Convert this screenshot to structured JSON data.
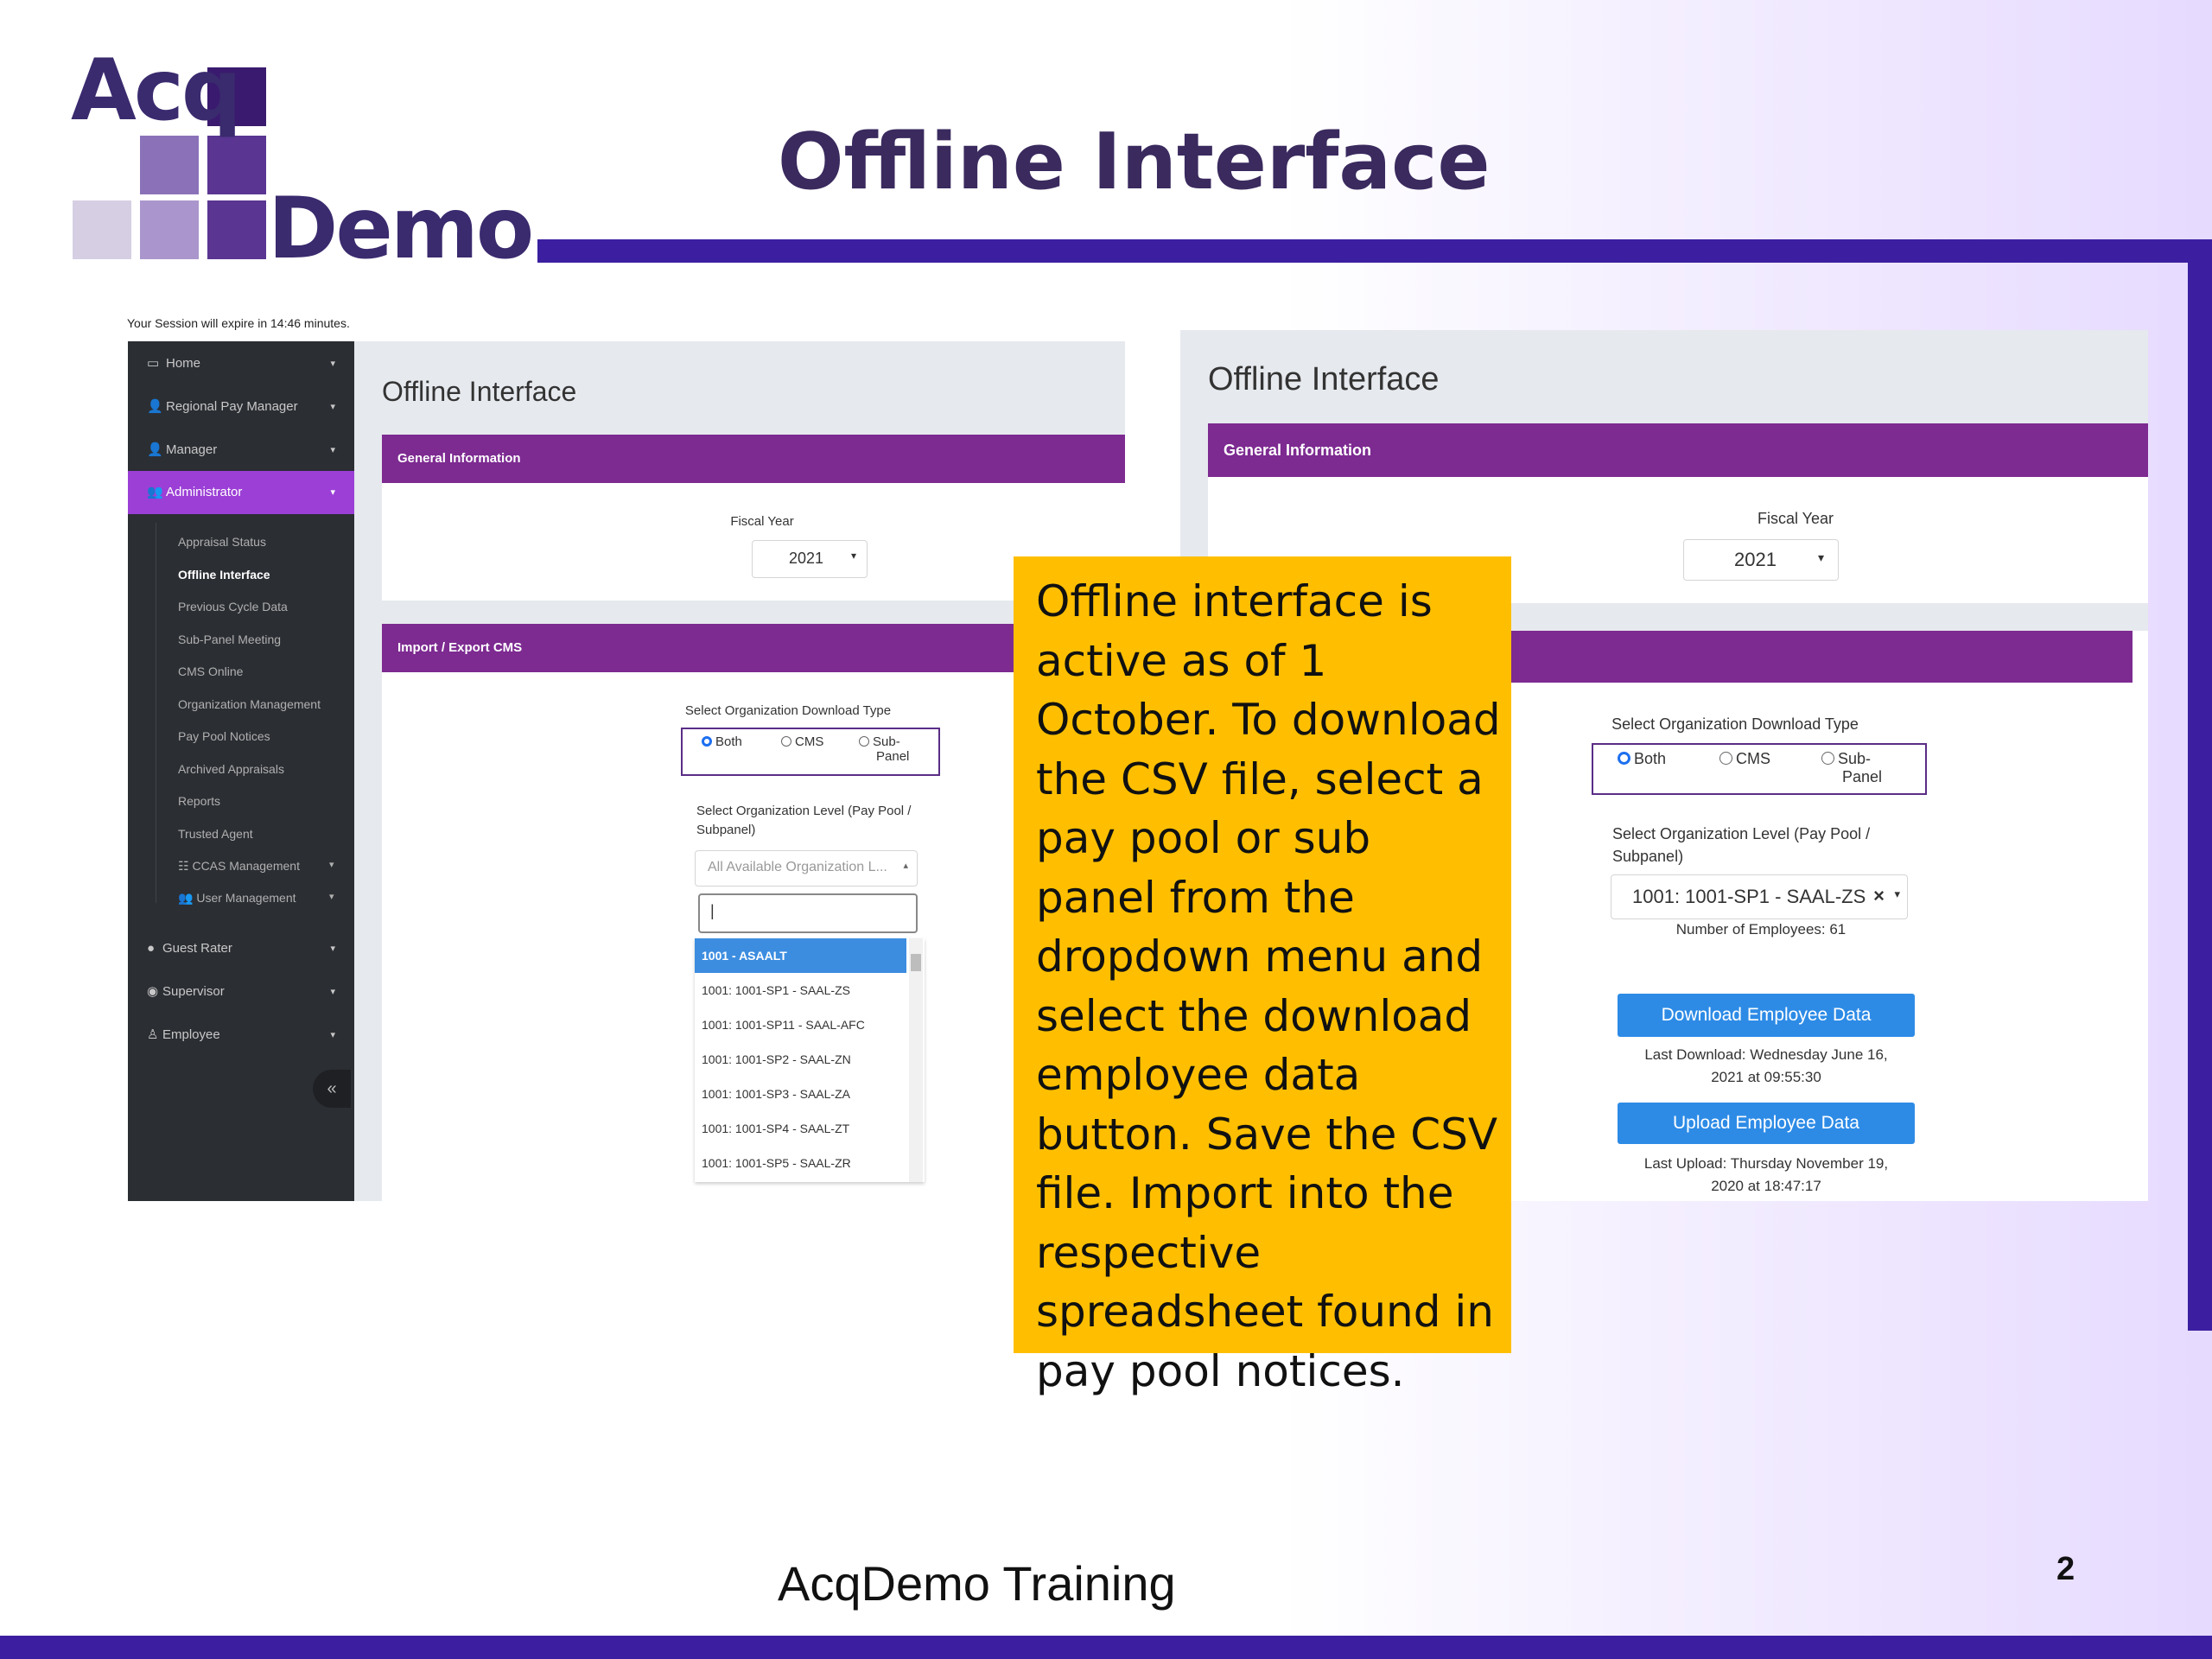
{
  "slide": {
    "title": "Offline Interface",
    "footer": "AcqDemo Training",
    "page_number": "2",
    "logo": {
      "line1": "Acq",
      "line2": "Demo"
    }
  },
  "colors": {
    "accent": "#3b1fa0",
    "purple_header": "#7d2a91",
    "sidebar_active": "#9b3fd6",
    "callout": "#ffbf00",
    "button": "#2d8be6"
  },
  "left_screen": {
    "session_notice": "Your Session will expire in 14:46 minutes.",
    "sidebar": {
      "items": [
        {
          "label": "Home",
          "icon": "laptop-icon"
        },
        {
          "label": "Regional Pay Manager",
          "icon": "user-gear-icon"
        },
        {
          "label": "Manager",
          "icon": "user-gear-icon"
        },
        {
          "label": "Administrator",
          "icon": "users-gear-icon"
        }
      ],
      "sub_items": [
        "Appraisal Status",
        "Offline Interface",
        "Previous Cycle Data",
        "Sub-Panel Meeting",
        "CMS Online",
        "Organization Management",
        "Pay Pool Notices",
        "Archived Appraisals",
        "Reports",
        "Trusted Agent",
        "CCAS Management",
        "User Management"
      ],
      "lower_items": [
        {
          "label": "Guest Rater",
          "icon": "guest-icon"
        },
        {
          "label": "Supervisor",
          "icon": "supervisor-icon"
        },
        {
          "label": "Employee",
          "icon": "employee-icon"
        }
      ],
      "collapse": "«"
    },
    "page_title": "Offline Interface",
    "general_info_header": "General Information",
    "fiscal_year_label": "Fiscal Year",
    "fiscal_year_value": "2021",
    "import_export_header": "Import / Export CMS",
    "download_type_label": "Select Organization Download Type",
    "radio_both": "Both",
    "radio_cms": "CMS",
    "radio_sub": "Sub-",
    "radio_sub2": "Panel",
    "org_level_label": "Select Organization Level (Pay Pool /",
    "org_level_label2": "Subpanel)",
    "org_select_placeholder": "All Available Organization L...",
    "search_value": "|",
    "dropdown_options": [
      "1001 - ASAALT",
      "1001: 1001-SP1 - SAAL-ZS",
      "1001: 1001-SP11 - SAAL-AFC",
      "1001: 1001-SP2 - SAAL-ZN",
      "1001: 1001-SP3 - SAAL-ZA",
      "1001: 1001-SP4 - SAAL-ZT",
      "1001: 1001-SP5 - SAAL-ZR"
    ]
  },
  "right_screen": {
    "page_title": "Offline Interface",
    "general_info_header": "General Information",
    "fiscal_year_label": "Fiscal Year",
    "fiscal_year_value": "2021",
    "download_type_label": "Select Organization Download Type",
    "radio_both": "Both",
    "radio_cms": "CMS",
    "radio_sub": "Sub-",
    "radio_sub2": "Panel",
    "org_level_label": "Select Organization Level (Pay Pool /",
    "org_level_label2": "Subpanel)",
    "org_selected": "1001: 1001-SP1 - SAAL-ZS",
    "employee_count": "Number of Employees: 61",
    "download_button": "Download Employee Data",
    "last_download": "Last Download: Wednesday June 16,",
    "last_download2": "2021 at 09:55:30",
    "upload_button": "Upload Employee Data",
    "last_upload": "Last Upload: Thursday November 19,",
    "last_upload2": "2020 at 18:47:17"
  },
  "callout": {
    "text": "Offline interface is active as of 1 October. To download the CSV file, select a pay pool or sub panel from the dropdown menu and select the download employee data button. Save the CSV file. Import into the respective spreadsheet found in pay pool notices."
  }
}
